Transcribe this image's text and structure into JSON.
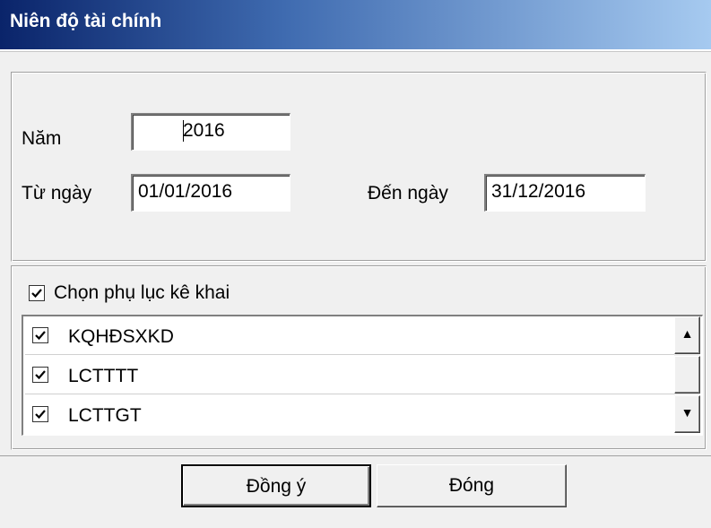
{
  "window": {
    "title": "Niên độ tài chính"
  },
  "fields": {
    "nam": {
      "label": "Năm",
      "value": "2016"
    },
    "tu_ngay": {
      "label": "Từ ngày",
      "value": "01/01/2016"
    },
    "den_ngay": {
      "label": "Đến ngày",
      "value": "31/12/2016"
    }
  },
  "appendix": {
    "select_label": "Chọn phụ lục kê khai",
    "select_checked": true,
    "items": [
      {
        "label": "KQHĐSXKD",
        "checked": true
      },
      {
        "label": "LCTTTT",
        "checked": true
      },
      {
        "label": "LCTTGT",
        "checked": true
      }
    ]
  },
  "scrollbar": {
    "up_icon": "arrow-up-icon",
    "down_icon": "arrow-down-icon"
  },
  "buttons": {
    "ok": "Đồng ý",
    "close": "Đóng"
  }
}
